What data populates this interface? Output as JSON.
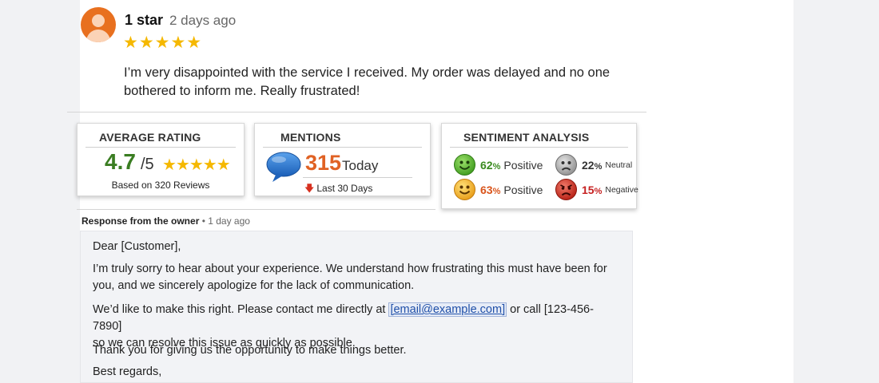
{
  "review": {
    "rating_label": "1 star",
    "time": "2 days ago",
    "stars": "★★★★★",
    "text": "I’m very disappointed with the service I received. My order was delayed and no one bothered to inform me. Really frustrated!"
  },
  "stats": {
    "average": {
      "title": "AVERAGE RATING",
      "value": "4.7",
      "denominator": "/5",
      "stars": "★★★★★",
      "based_on": "Based on 320 Reviews"
    },
    "mentions": {
      "title": "MENTIONS",
      "count": "315",
      "period": "Today",
      "last_label": "Last 30 Days"
    },
    "sentiment": {
      "title": "SENTIMENT ANALYSIS",
      "items": [
        {
          "pct": "62",
          "unit": "%",
          "label": "Positive",
          "color": "#3a8a1f"
        },
        {
          "pct": "22",
          "unit": "%",
          "label": "Neutral",
          "color": "#333333"
        },
        {
          "pct": "63",
          "unit": "%",
          "label": "Positive",
          "color": "#d9541b"
        },
        {
          "pct": "15",
          "unit": "%",
          "label": "Negative",
          "color": "#c62020"
        }
      ]
    }
  },
  "response": {
    "owner_label": "Response from the owner",
    "separator": " • ",
    "time": "1 day ago",
    "greeting": "Dear [Customer],",
    "para1": "I’m truly sorry to hear about your experience. We understand how frustrating this must have been for you, and we sincerely apologize for the lack of communication.",
    "para2_before": "We’d like to make this right. Please contact me directly at ",
    "email": "[email@example.com]",
    "para2_mid": " or call ",
    "phone": "[123-456-7890]",
    "para2_after": "so we can resolve this issue as quickly as possible.",
    "para3": "Thank you for giving us the opportunity to make things better.",
    "closing": "Best regards,"
  },
  "icons": {
    "avatar": "user-avatar-icon",
    "mentions": "speech-bubble-icon",
    "trend": "arrow-down-icon",
    "faces": [
      "happy-face-icon",
      "sad-face-icon",
      "smile-face-icon",
      "angry-face-icon"
    ]
  },
  "colors": {
    "star": "#f5b800",
    "avatar": "#e8701f",
    "avg_value": "#3a7d22",
    "mentions_count": "#e06224",
    "link": "#1f4fa8"
  }
}
